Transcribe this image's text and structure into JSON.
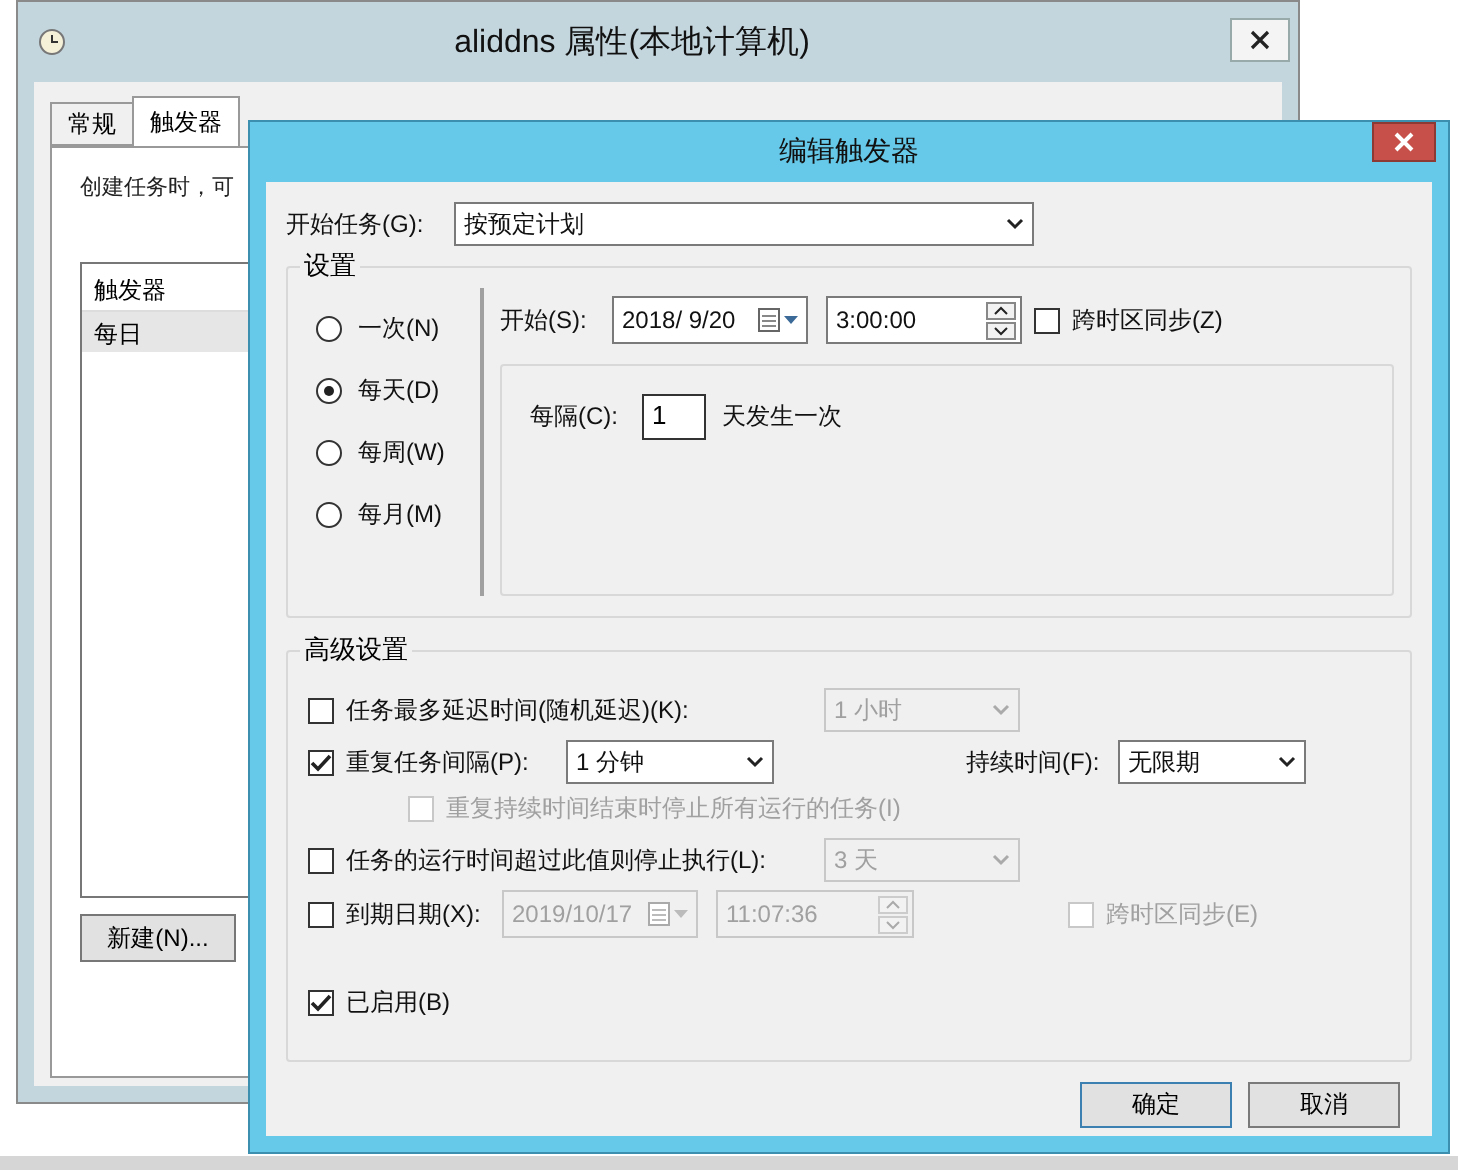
{
  "background_window": {
    "title": "aliddns 属性(本地计算机)",
    "tabs": [
      {
        "label": "常规",
        "selected": false
      },
      {
        "label": "触发器",
        "selected": true
      }
    ],
    "description": "创建任务时，可",
    "list": {
      "header": "触发器",
      "rows": [
        {
          "label": "每日",
          "selected": true
        }
      ]
    },
    "buttons": [
      "新建(N)..."
    ]
  },
  "dialog": {
    "title": "编辑触发器",
    "start_task": {
      "label": "开始任务(G):",
      "value": "按预定计划"
    },
    "settings": {
      "title": "设置",
      "schedule_options": [
        {
          "label": "一次(N)",
          "selected": false
        },
        {
          "label": "每天(D)",
          "selected": true
        },
        {
          "label": "每周(W)",
          "selected": false
        },
        {
          "label": "每月(M)",
          "selected": false
        }
      ],
      "start": {
        "label": "开始(S):",
        "date": "2018/  9/20",
        "time": "3:00:00"
      },
      "sync_timezone": {
        "label": "跨时区同步(Z)",
        "checked": false
      },
      "recur": {
        "label": "每隔(C):",
        "value": "1",
        "suffix": "天发生一次"
      }
    },
    "advanced": {
      "title": "高级设置",
      "delay": {
        "label": "任务最多延迟时间(随机延迟)(K):",
        "checked": false,
        "value": "1 小时",
        "disabled": true
      },
      "repeat": {
        "label": "重复任务间隔(P):",
        "checked": true,
        "value": "1 分钟",
        "duration_label": "持续时间(F):",
        "duration_value": "无限期"
      },
      "stop_all": {
        "label": "重复持续时间结束时停止所有运行的任务(I)",
        "checked": false,
        "disabled": true
      },
      "stop_if": {
        "label": "任务的运行时间超过此值则停止执行(L):",
        "checked": false,
        "value": "3 天",
        "disabled": true
      },
      "expire": {
        "label": "到期日期(X):",
        "checked": false,
        "date": "2019/10/17",
        "time": "11:07:36",
        "disabled": true,
        "sync": {
          "label": "跨时区同步(E)",
          "checked": false,
          "disabled": true
        }
      },
      "enabled": {
        "label": "已启用(B)",
        "checked": true
      }
    },
    "buttons": [
      {
        "label": "确定",
        "kind": "default"
      },
      {
        "label": "取消",
        "kind": "normal"
      }
    ]
  }
}
